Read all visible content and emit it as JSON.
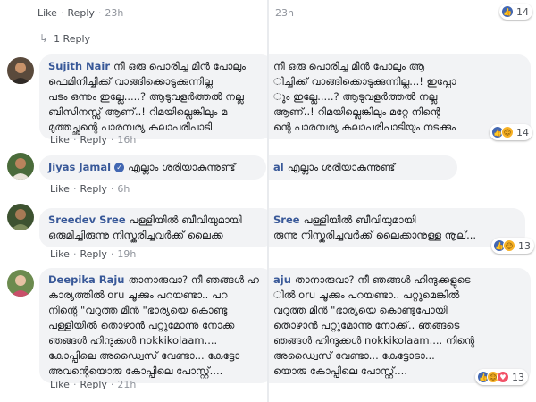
{
  "actions": {
    "like": "Like",
    "reply": "Reply",
    "separator": "·"
  },
  "top_comment": {
    "time": "23h",
    "reaction_count": "14"
  },
  "reply_link": {
    "label": "1 Reply"
  },
  "comments": [
    {
      "author": "Sujith Nair",
      "lines_left": [
        "നീ ഒരു പൊരിച്ച മീൻ പോലും",
        "ഫെമിനിച്ചിക്ക് വാങ്ങിക്കൊടുക്കുന്നില്ല",
        "പടം ഒന്നും ഇല്ലേ.....? ആടുവളർത്തൽ നല്ല",
        "ബിസിനസ്സ് ആണ്..! റിമയില്ലെങ്കിലും മ",
        "മുത്തച്ഛന്റെ പാരമ്പര്യ കലാപരിപാടി"
      ],
      "lines_right": [
        "നീ ഒരു പൊരിച്ച മീൻ പോലും ആ",
        "ിച്ചിക്ക് വാങ്ങിക്കൊടുക്കുന്നില്ല...! ഇപ്പോ",
        "ും ഇല്ലേ.....? ആടുവളർത്തൽ നല്ല",
        "ആണ്..! റിമയില്ലെങ്കിലും മറ്റേ നിന്റെ",
        "ന്റെ പാരമ്പര്യ കലാപരിപാടിയും നടക്കും"
      ],
      "time": "16h",
      "reaction_count": "14"
    },
    {
      "author": "Jiyas Jamal",
      "author_right": "al",
      "lines_left": [
        "എല്ലാം ശരിയാകുന്നുണ്ട്"
      ],
      "lines_right": [
        "എല്ലാം ശരിയാകുന്നുണ്ട്"
      ],
      "time": "6h"
    },
    {
      "author": "Sreedev Sree",
      "author_right": "Sree",
      "lines_left": [
        "പള്ളിയിൽ ബീവിയുമായി",
        "ഒരുമിച്ചിരുന്നു നിസ്കരിച്ചവർക്ക് ലൈക്ക"
      ],
      "lines_right": [
        "പള്ളിയിൽ ബീവിയുമായി",
        "രുന്നു നിസ്കരിച്ചവർക്ക് ലൈക്കാനുള്ള നൂല്..."
      ],
      "time": "19h",
      "reaction_count": "13"
    },
    {
      "author": "Deepika Raju",
      "author_right": "aju",
      "lines_left": [
        "താനാരുവാ? നീ ഞങ്ങൾ ഹ",
        "കാര്യത്തിൽ oru ചൂക്കും പറയണ്ടാ.. പറ",
        "നിന്റെ \"വറുത്ത മീൻ \"ഭാര്യയെ കൊണ്ടു",
        "പള്ളിയിൽ തൊഴാൻ പറ്റുമോന്നു നോക്ക",
        "ഞങ്ങൾ ഹിന്ദുക്കൾ nokkikolaam....",
        "കോപ്പിലെ അഡ്വൈസ് വേണ്ടാ... കേട്ടോ",
        "അവന്റെയൊരു കോപ്പിലെ പോസ്റ്റ്...."
      ],
      "lines_right": [
        "താനാരുവാ? നീ ഞങ്ങൾ ഹിന്ദുക്കളുടെ",
        "ിൽ oru ചൂക്കും പറയണ്ടാ.. പറ്റുമെങ്കിൽ",
        "വറുത്ത മീൻ \"ഭാര്യയെ കൊണ്ടുപോയി",
        "തൊഴാൻ പറ്റുമോന്നു നോക്ക്.. ഞങ്ങടെ",
        "ഞങ്ങൾ ഹിന്ദുക്കൾ nokkikolaam.... നിന്റെ",
        "അഡ്വൈസ് വേണ്ടാ... കേട്ടോടാ...",
        "യൊരു കോപ്പിലെ പോസ്റ്റ്...."
      ],
      "time": "21h",
      "reaction_count": "13"
    }
  ],
  "colors": {
    "author": "#385898",
    "bubble": "#f2f3f5",
    "like": "#4267b2",
    "haha": "#f7b125",
    "love": "#f25268"
  },
  "icons": [
    "reply-arrow-icon",
    "verified-badge-icon",
    "like-reaction-icon",
    "haha-reaction-icon",
    "love-reaction-icon"
  ]
}
